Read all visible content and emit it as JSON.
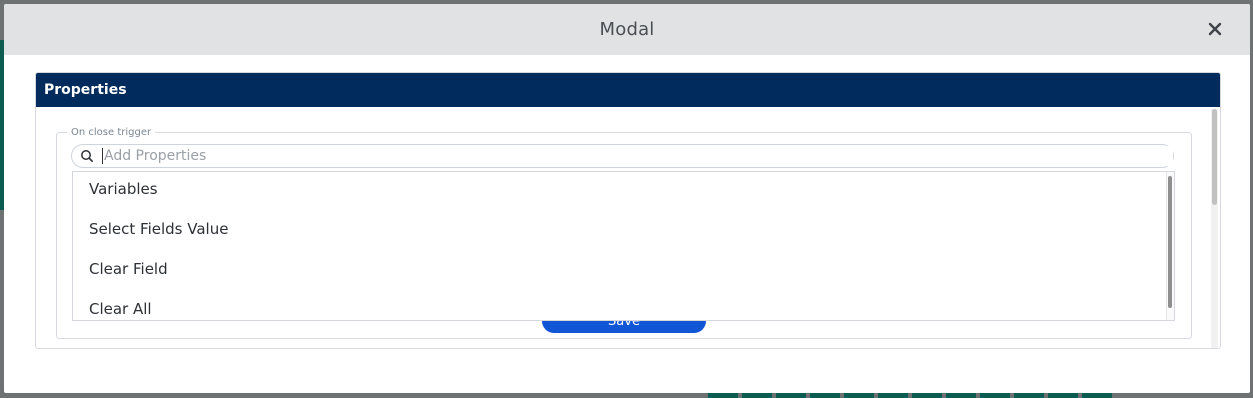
{
  "modal": {
    "title": "Modal",
    "close_icon": "close-icon"
  },
  "panel": {
    "title": "Properties",
    "fieldset_label": "On close trigger"
  },
  "search": {
    "placeholder": "Add Properties",
    "value": "",
    "icon": "search-icon"
  },
  "dropdown": {
    "options": [
      "Variables",
      "Select Fields Value",
      "Clear Field",
      "Clear All"
    ]
  },
  "save_button": {
    "label": "Save"
  },
  "colors": {
    "header_bg": "#e1e2e3",
    "panel_header_bg": "#002b5c",
    "save_button_bg": "#1156d4",
    "overlay": "#6f7272"
  }
}
